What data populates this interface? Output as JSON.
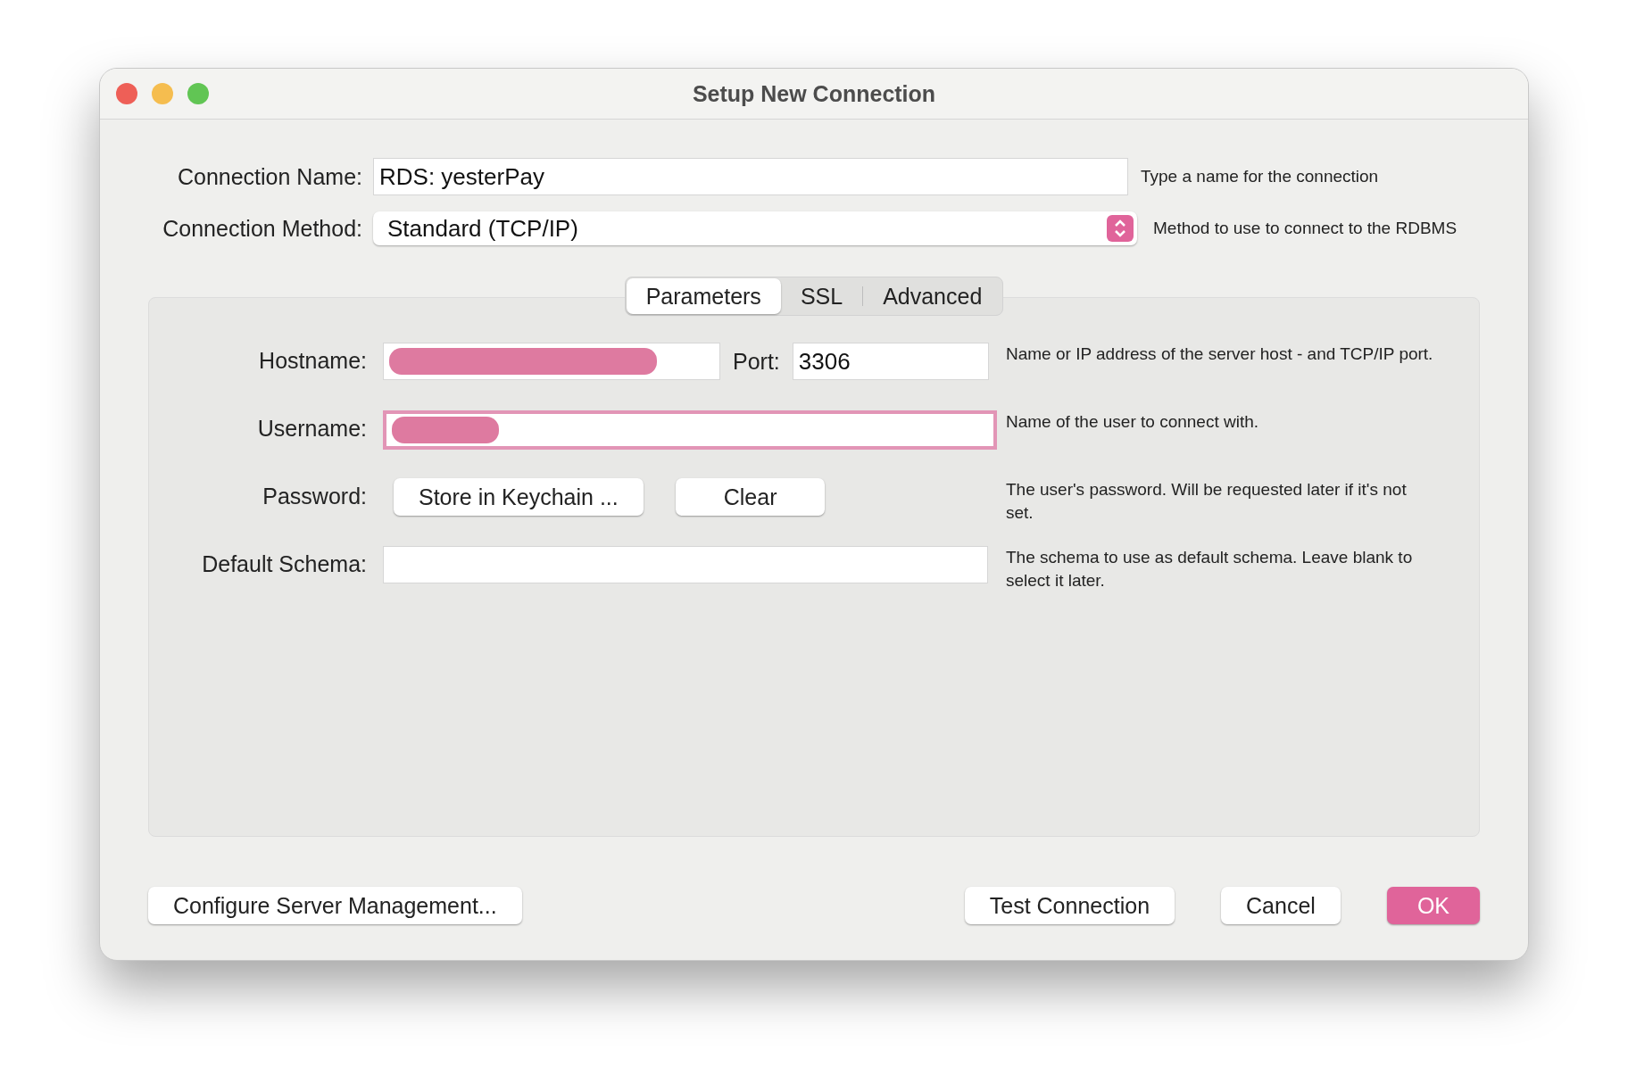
{
  "window": {
    "title": "Setup New Connection"
  },
  "connection_name": {
    "label": "Connection Name:",
    "value": "RDS: yesterPay",
    "hint": "Type a name for the connection"
  },
  "connection_method": {
    "label": "Connection Method:",
    "value": "Standard (TCP/IP)",
    "hint": "Method to use to connect to the RDBMS"
  },
  "tabs": [
    {
      "label": "Parameters",
      "selected": true
    },
    {
      "label": "SSL",
      "selected": false
    },
    {
      "label": "Advanced",
      "selected": false
    }
  ],
  "parameters": [
    {
      "kind": "host",
      "label": "Hostname:",
      "redacted": true,
      "focused": false,
      "port_label": "Port:",
      "port_value": "3306",
      "hint": "Name or IP address of the server host - and TCP/IP port."
    },
    {
      "kind": "text",
      "label": "Username:",
      "redacted": true,
      "focused": true,
      "hint": "Name of the user to connect with."
    },
    {
      "kind": "buttons",
      "label": "Password:",
      "buttons": [
        "Store in Keychain ...",
        "Clear"
      ],
      "hint": "The user's password. Will be requested later if it's not set."
    },
    {
      "kind": "text",
      "label": "Default Schema:",
      "redacted": false,
      "focused": false,
      "hint": "The schema to use as default schema. Leave blank to select it later."
    }
  ],
  "footer": {
    "left_button": "Configure Server Management...",
    "buttons": [
      {
        "label": "Test Connection",
        "primary": false
      },
      {
        "label": "Cancel",
        "primary": false
      },
      {
        "label": "OK",
        "primary": true
      }
    ]
  }
}
